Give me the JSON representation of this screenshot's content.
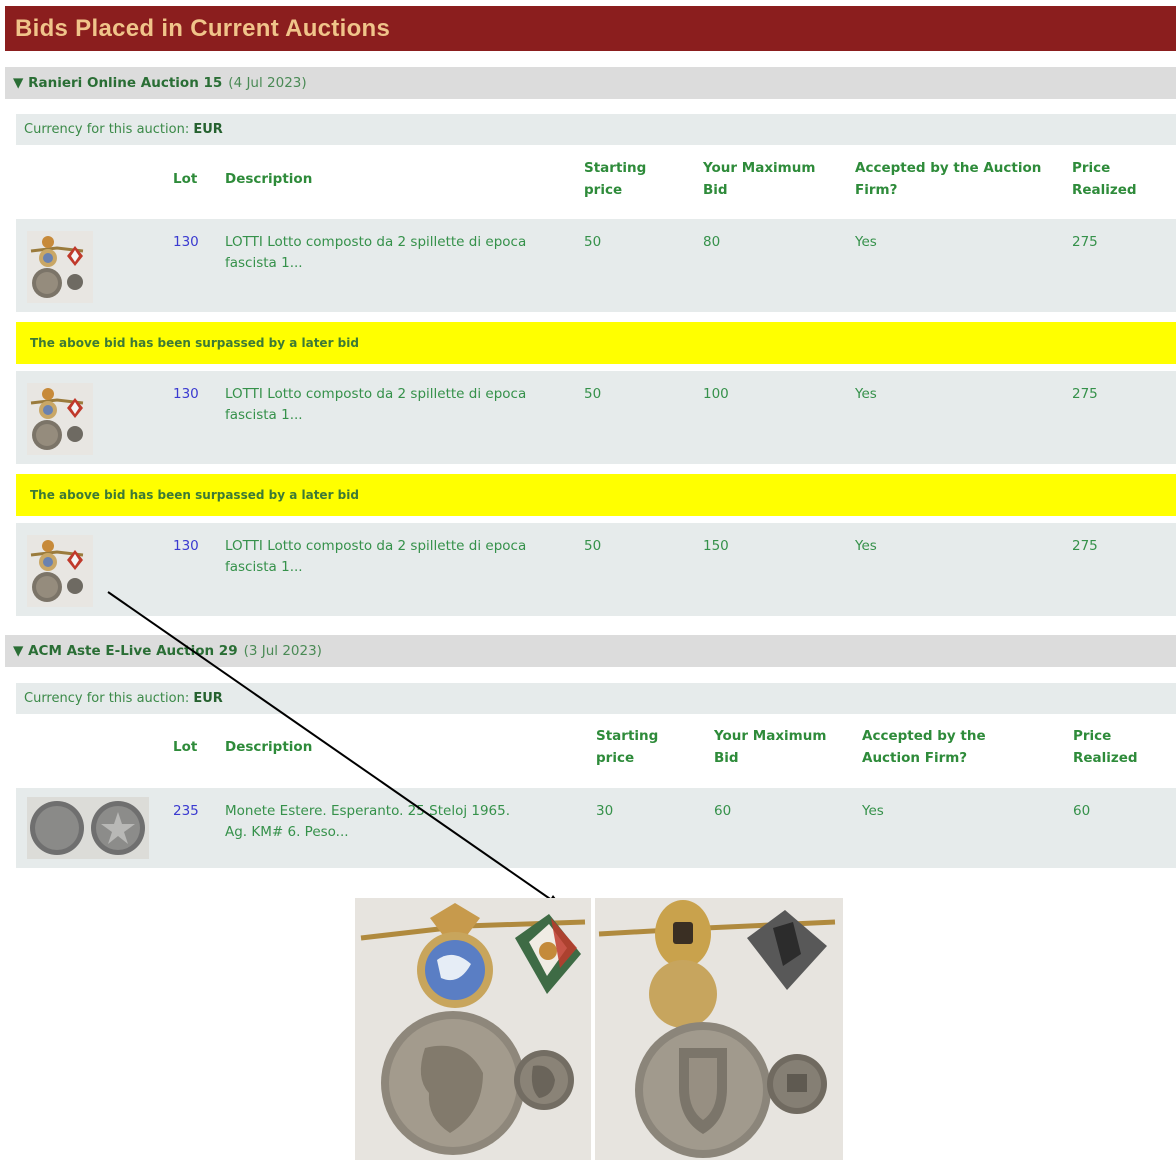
{
  "page_title": "Bids Placed in Current Auctions",
  "auction1": {
    "name": "▼ Ranieri Online Auction 15",
    "date": "(4 Jul 2023)",
    "currency_label": "Currency for this auction:",
    "currency": "EUR",
    "columns": {
      "lot": "Lot",
      "description": "Description",
      "starting_line1": "Starting",
      "starting_line2": "price",
      "maxbid_line1": "Your Maximum",
      "maxbid_line2": "Bid",
      "accepted_line1": "Accepted by the Auction",
      "accepted_line2": "Firm?",
      "price_line1": "Price",
      "price_line2": "Realized"
    },
    "bids": [
      {
        "lot": "130",
        "desc_line1": "LOTTI Lotto composto da 2 spillette di epoca",
        "desc_line2": "fascista 1...",
        "starting": "50",
        "max_bid": "80",
        "accepted": "Yes",
        "realized": "275"
      },
      {
        "lot": "130",
        "desc_line1": "LOTTI Lotto composto da 2 spillette di epoca",
        "desc_line2": "fascista 1...",
        "starting": "50",
        "max_bid": "100",
        "accepted": "Yes",
        "realized": "275"
      },
      {
        "lot": "130",
        "desc_line1": "LOTTI Lotto composto da 2 spillette di epoca",
        "desc_line2": "fascista 1...",
        "starting": "50",
        "max_bid": "150",
        "accepted": "Yes",
        "realized": "275"
      }
    ],
    "surpassed_message": "The above bid has been surpassed by a later bid"
  },
  "auction2": {
    "name": "▼ ACM Aste E-Live Auction 29",
    "date": "(3 Jul 2023)",
    "currency_label": "Currency for this auction:",
    "currency": "EUR",
    "columns": {
      "lot": "Lot",
      "description": "Description",
      "starting_line1": "Starting",
      "starting_line2": "price",
      "maxbid_line1": "Your Maximum",
      "maxbid_line2": "Bid",
      "accepted_line1": "Accepted by the",
      "accepted_line2": "Auction Firm?",
      "price_line1": "Price",
      "price_line2": "Realized"
    },
    "bids": [
      {
        "lot": "235",
        "desc_line1": "Monete Estere. Esperanto. 25 Steloj 1965.",
        "desc_line2": "Ag. KM# 6. Peso...",
        "starting": "30",
        "max_bid": "60",
        "accepted": "Yes",
        "realized": "60"
      }
    ]
  },
  "colors": {
    "header_bg": "#8b1e1e",
    "header_text": "#f0c48a",
    "row_bg": "#e6ebeb",
    "warning_bg": "#ffff00",
    "text_green": "#2e8b3a",
    "lot_link": "#3a3ad0"
  },
  "icons": [
    "lot-thumbnail",
    "coin-thumbnail",
    "expand-arrow"
  ]
}
